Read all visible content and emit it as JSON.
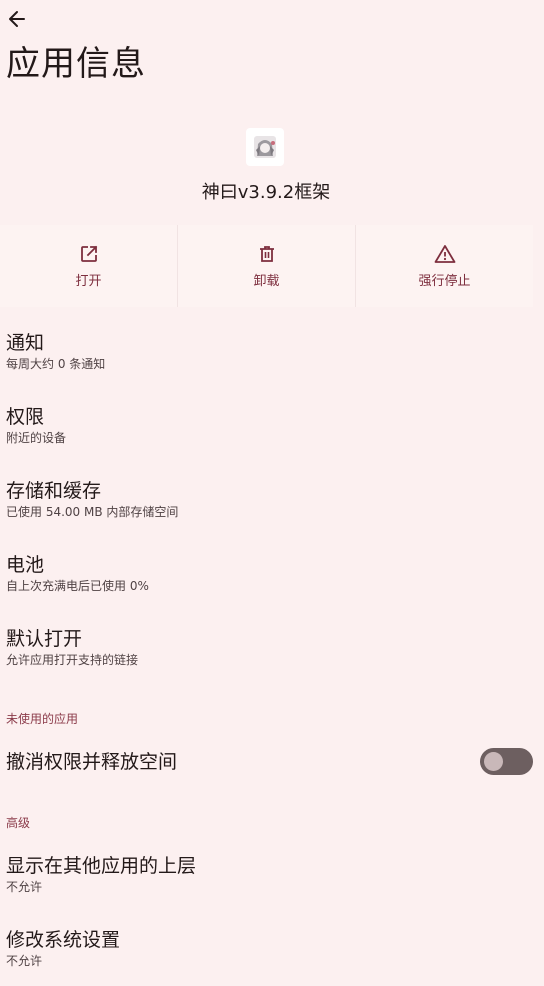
{
  "header": {
    "title": "应用信息"
  },
  "app": {
    "name": "神曰v3.9.2框架"
  },
  "actions": [
    {
      "label": "打开",
      "icon": "open-external-icon"
    },
    {
      "label": "卸载",
      "icon": "trash-icon"
    },
    {
      "label": "强行停止",
      "icon": "warning-icon"
    }
  ],
  "items": {
    "notifications": {
      "title": "通知",
      "subtitle": "每周大约 0 条通知"
    },
    "permissions": {
      "title": "权限",
      "subtitle": "附近的设备"
    },
    "storage": {
      "title": "存储和缓存",
      "subtitle": "已使用 54.00 MB 内部存储空间"
    },
    "battery": {
      "title": "电池",
      "subtitle": "自上次充满电后已使用 0%"
    },
    "open_by_default": {
      "title": "默认打开",
      "subtitle": "允许应用打开支持的链接"
    }
  },
  "unused_section": {
    "header": "未使用的应用",
    "revoke": {
      "title": "撤消权限并释放空间",
      "enabled": false
    }
  },
  "advanced_section": {
    "header": "高级",
    "overlay": {
      "title": "显示在其他应用的上层",
      "subtitle": "不允许"
    },
    "modify_settings": {
      "title": "修改系统设置",
      "subtitle": "不允许"
    }
  },
  "colors": {
    "background": "#fcf0f0",
    "accent": "#7d2e3e",
    "text": "#231919"
  }
}
